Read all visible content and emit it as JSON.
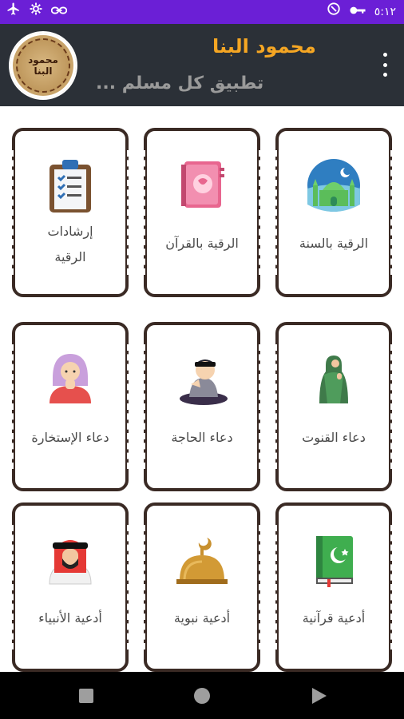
{
  "status_bar": {
    "time": "٥:١٢",
    "icons_left": [
      "airplane-icon",
      "settings-icon",
      "link-icon"
    ],
    "icons_right": [
      "data-saver-icon",
      "key-icon"
    ]
  },
  "app_bar": {
    "avatar_text": "محمود البنا",
    "title": "محمود البنا",
    "subtitle": "تطبيق كل مسلم ..."
  },
  "cards": [
    {
      "label_1": "الرقية بالسنة",
      "label_2": "",
      "icon": "mosque-icon"
    },
    {
      "label_1": "الرقية بالقرآن",
      "label_2": "",
      "icon": "quran-book-icon"
    },
    {
      "label_1": "إرشادات",
      "label_2": "الرقية",
      "icon": "clipboard-checklist-icon"
    },
    {
      "label_1": "دعاء القنوت",
      "label_2": "",
      "icon": "praying-woman-icon"
    },
    {
      "label_1": "دعاء الحاجة",
      "label_2": "",
      "icon": "praying-boy-icon"
    },
    {
      "label_1": "دعاء الإستخارة",
      "label_2": "",
      "icon": "praying-girl-icon"
    },
    {
      "label_1": "أدعية قرآنية",
      "label_2": "",
      "icon": "green-quran-icon"
    },
    {
      "label_1": "أدعية نبوية",
      "label_2": "",
      "icon": "dome-icon"
    },
    {
      "label_1": "أدعية الأنبياء",
      "label_2": "",
      "icon": "prophet-man-icon"
    }
  ],
  "nav_bar": {
    "buttons": [
      "recent-apps-button",
      "home-button",
      "back-button"
    ]
  },
  "colors": {
    "status_bar": "#6b1fd6",
    "app_bar": "#2b3037",
    "title": "#f5a623",
    "subtitle": "#9a9a9a",
    "card_border": "#3a2a24",
    "card_text": "#4a4a4a"
  }
}
